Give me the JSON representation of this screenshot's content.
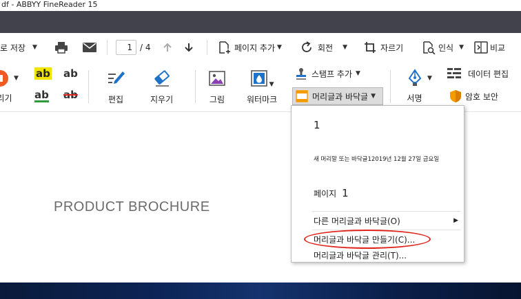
{
  "window": {
    "title": "df - ABBYY FineReader 15"
  },
  "toolbar": {
    "save_label": "로 저장",
    "page_current": "1",
    "page_total": "/ 4",
    "add_page_label": "페이지 추가",
    "rotate_label": "회전",
    "crop_label": "자르기",
    "recognize_label": "인식",
    "compare_label": "비교"
  },
  "ribbon": {
    "annotate_label": "리기",
    "edit_label": "편집",
    "erase_label": "지우기",
    "image_label": "그림",
    "watermark_label": "워터마크",
    "stamp_label": "스탬프 추가",
    "header_footer_label": "머리글과 바닥글",
    "sign_label": "서명",
    "data_edit_label": "데이터 편집",
    "password_label": "암호 보안",
    "highlight_text": "ab"
  },
  "document": {
    "title": "PRODUCT BROCHURE"
  },
  "menu": {
    "item1": "1",
    "item2": "새 머리말 또는 바닥글12019년 12월 27일 금요일",
    "item3_prefix": "페이지",
    "item3_num": "1",
    "other": "다른 머리글과 바닥글(O)",
    "create": "머리글과 바닥글 만들기(C)...",
    "manage": "머리글과 바닥글 관리(T)..."
  },
  "colors": {
    "title_bar_dark": "#42424c",
    "highlight": "#f2e400",
    "annotation_orange": "#f05a24",
    "accent_orange": "#f59b00",
    "icon_blue": "#1e73c8",
    "circle_red": "#e2231a"
  }
}
